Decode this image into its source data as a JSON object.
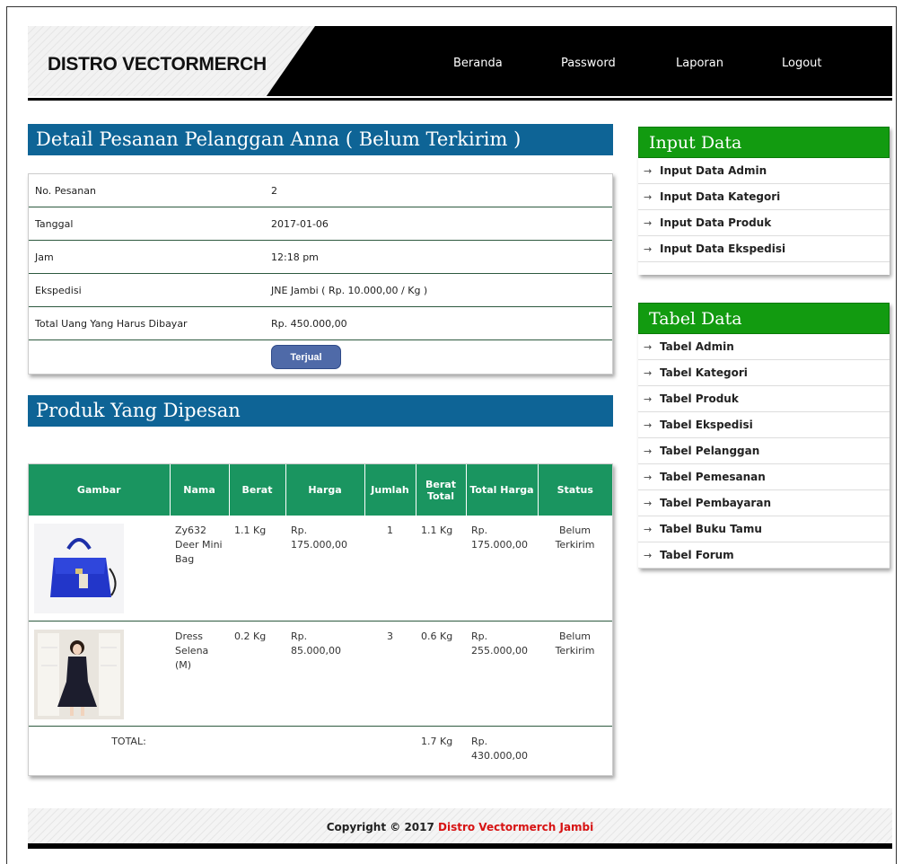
{
  "header": {
    "logo": "DISTRO VECTORMERCH",
    "nav": [
      "Beranda",
      "Password",
      "Laporan",
      "Logout"
    ]
  },
  "detail": {
    "title": "Detail Pesanan Pelanggan Anna ( Belum Terkirim )",
    "rows": [
      {
        "label": "No. Pesanan",
        "value": "2"
      },
      {
        "label": "Tanggal",
        "value": "2017-01-06"
      },
      {
        "label": "Jam",
        "value": "12:18 pm"
      },
      {
        "label": "Ekspedisi",
        "value": "JNE Jambi ( Rp. 10.000,00 / Kg )"
      },
      {
        "label": "Total Uang Yang Harus Dibayar",
        "value": "Rp. 450.000,00"
      }
    ],
    "button": "Terjual"
  },
  "products": {
    "title": "Produk Yang Dipesan",
    "headers": [
      "Gambar",
      "Nama",
      "Berat",
      "Harga",
      "Jumlah",
      "Berat Total",
      "Total Harga",
      "Status"
    ],
    "items": [
      {
        "nama": "Zy632 Deer Mini Bag",
        "berat": "1.1 Kg",
        "harga": "Rp. 175.000,00",
        "jumlah": "1",
        "berat_total": "1.1 Kg",
        "total_harga": "Rp. 175.000,00",
        "status": "Belum Terkirim"
      },
      {
        "nama": "Dress Selena (M)",
        "berat": "0.2 Kg",
        "harga": "Rp. 85.000,00",
        "jumlah": "3",
        "berat_total": "0.6 Kg",
        "total_harga": "Rp. 255.000,00",
        "status": "Belum Terkirim"
      }
    ],
    "total": {
      "label": "TOTAL:",
      "berat_total": "1.7 Kg",
      "total_harga": "Rp. 430.000,00"
    }
  },
  "sidebar": {
    "input": {
      "title": "Input Data",
      "items": [
        "Input Data Admin",
        "Input Data Kategori",
        "Input Data Produk",
        "Input Data Ekspedisi"
      ]
    },
    "tabel": {
      "title": "Tabel Data",
      "items": [
        "Tabel Admin",
        "Tabel Kategori",
        "Tabel Produk",
        "Tabel Ekspedisi",
        "Tabel Pelanggan",
        "Tabel Pemesanan",
        "Tabel Pembayaran",
        "Tabel Buku Tamu",
        "Tabel Forum"
      ]
    },
    "arrow": "→"
  },
  "footer": {
    "prefix": "Copyright © 2017 ",
    "brand": "Distro Vectormerch Jambi"
  },
  "colors": {
    "header_bg": "#000000",
    "section_title": "#0e6496",
    "table_header": "#1a9560",
    "sidebar_title": "#129b10",
    "button": "#4f6aa8",
    "brand_red": "#d71313"
  }
}
